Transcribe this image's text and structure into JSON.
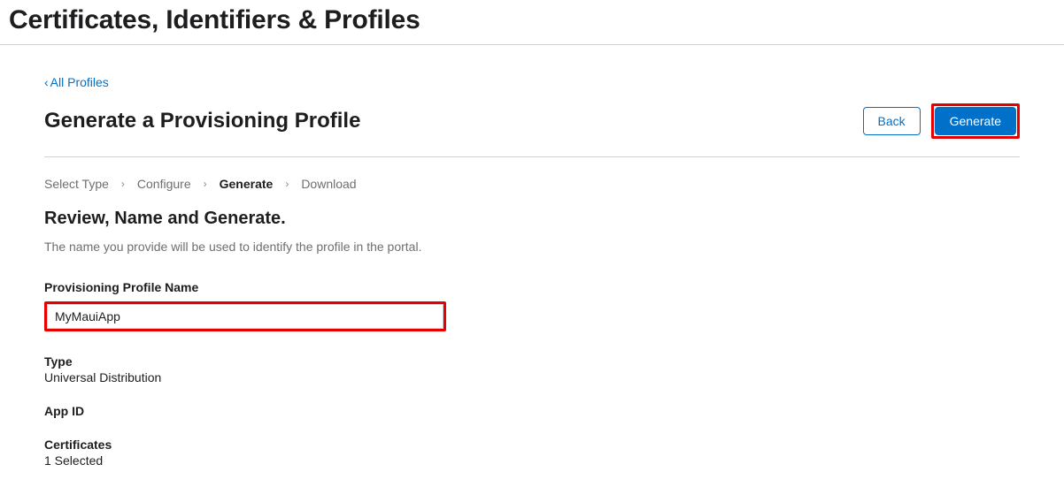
{
  "header": {
    "title": "Certificates, Identifiers & Profiles"
  },
  "nav": {
    "back_link_text": "All Profiles"
  },
  "page": {
    "title": "Generate a Provisioning Profile",
    "back_button": "Back",
    "generate_button": "Generate"
  },
  "breadcrumb": {
    "steps": [
      "Select Type",
      "Configure",
      "Generate",
      "Download"
    ],
    "active_index": 2
  },
  "section": {
    "heading": "Review, Name and Generate.",
    "subtext": "The name you provide will be used to identify the profile in the portal."
  },
  "form": {
    "name_label": "Provisioning Profile Name",
    "name_value": "MyMauiApp"
  },
  "details": {
    "type_label": "Type",
    "type_value": "Universal Distribution",
    "appid_label": "App ID",
    "appid_value": "",
    "certs_label": "Certificates",
    "certs_value": "1 Selected"
  }
}
